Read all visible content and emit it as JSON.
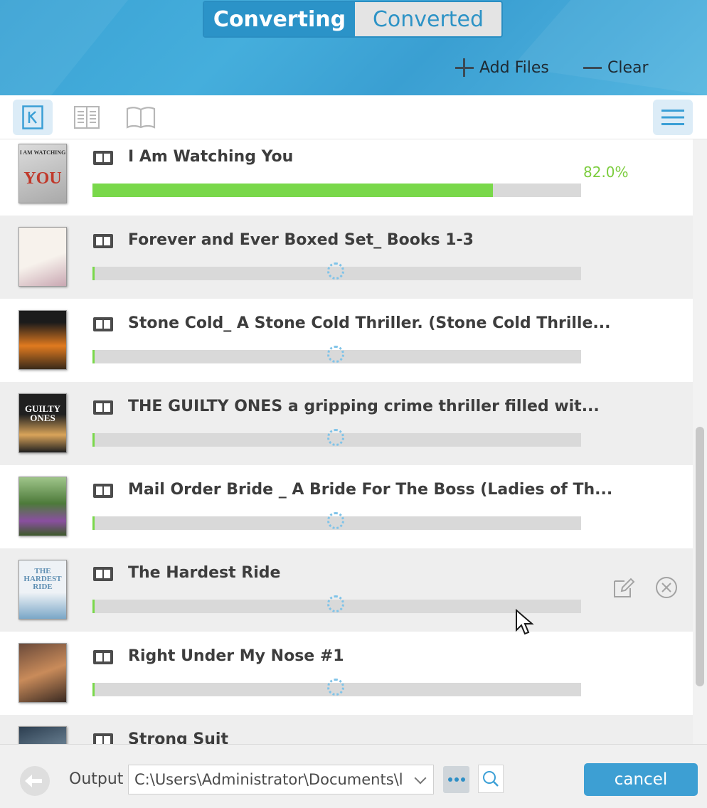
{
  "header": {
    "tabs": [
      {
        "label": "Converting",
        "active": true
      },
      {
        "label": "Converted",
        "active": false
      }
    ],
    "actions": {
      "add_files": "Add Files",
      "clear": "Clear"
    }
  },
  "toolbar": {
    "icons": [
      "kindle-view-icon",
      "page-view-icon",
      "open-book-icon"
    ],
    "menu_icon": "hamburger-menu-icon"
  },
  "books": [
    {
      "title": "I Am Watching You",
      "progress_percent": 82.0,
      "progress_label": "82.0%",
      "cover_text": "YOU",
      "cover_colors": [
        "#cfcfcf",
        "#c0392b"
      ]
    },
    {
      "title": "Forever and Ever Boxed Set_ Books 1-3",
      "status": "loading",
      "cover_colors": [
        "#f4efe9",
        "#c9a7b2"
      ]
    },
    {
      "title": "Stone Cold_ A Stone Cold Thriller. (Stone Cold Thrille...",
      "status": "loading",
      "cover_colors": [
        "#1b1b1b",
        "#e07a1f"
      ]
    },
    {
      "title": "THE GUILTY ONES a gripping crime thriller filled wit...",
      "status": "loading",
      "cover_text": "GUILTY ONES",
      "cover_colors": [
        "#202020",
        "#d9a45a"
      ]
    },
    {
      "title": "Mail Order Bride _ A Bride For The Boss (Ladies of Th...",
      "status": "loading",
      "cover_colors": [
        "#4d7a3a",
        "#8a4fa0"
      ]
    },
    {
      "title": "The Hardest Ride",
      "status": "loading",
      "cover_text": "THE HARDEST RIDE",
      "cover_colors": [
        "#e9eef3",
        "#7aa7c7"
      ],
      "row_actions": [
        "edit-icon",
        "remove-icon"
      ]
    },
    {
      "title": "Right Under My Nose #1",
      "status": "loading",
      "cover_colors": [
        "#3a2a22",
        "#c98b5a"
      ]
    },
    {
      "title": "Strong Suit",
      "status": "loading",
      "cover_colors": [
        "#2c3e50",
        "#a9c4d6"
      ]
    }
  ],
  "footer": {
    "output_label": "Output",
    "output_path": "C:\\Users\\Administrator\\Documents\\l",
    "more_icon": "more-dots-icon",
    "search_icon": "search-icon",
    "cancel_label": "cancel"
  },
  "colors": {
    "accent": "#3d9fd3",
    "progress_green": "#79d84a",
    "percent_text": "#7ccd3e"
  }
}
